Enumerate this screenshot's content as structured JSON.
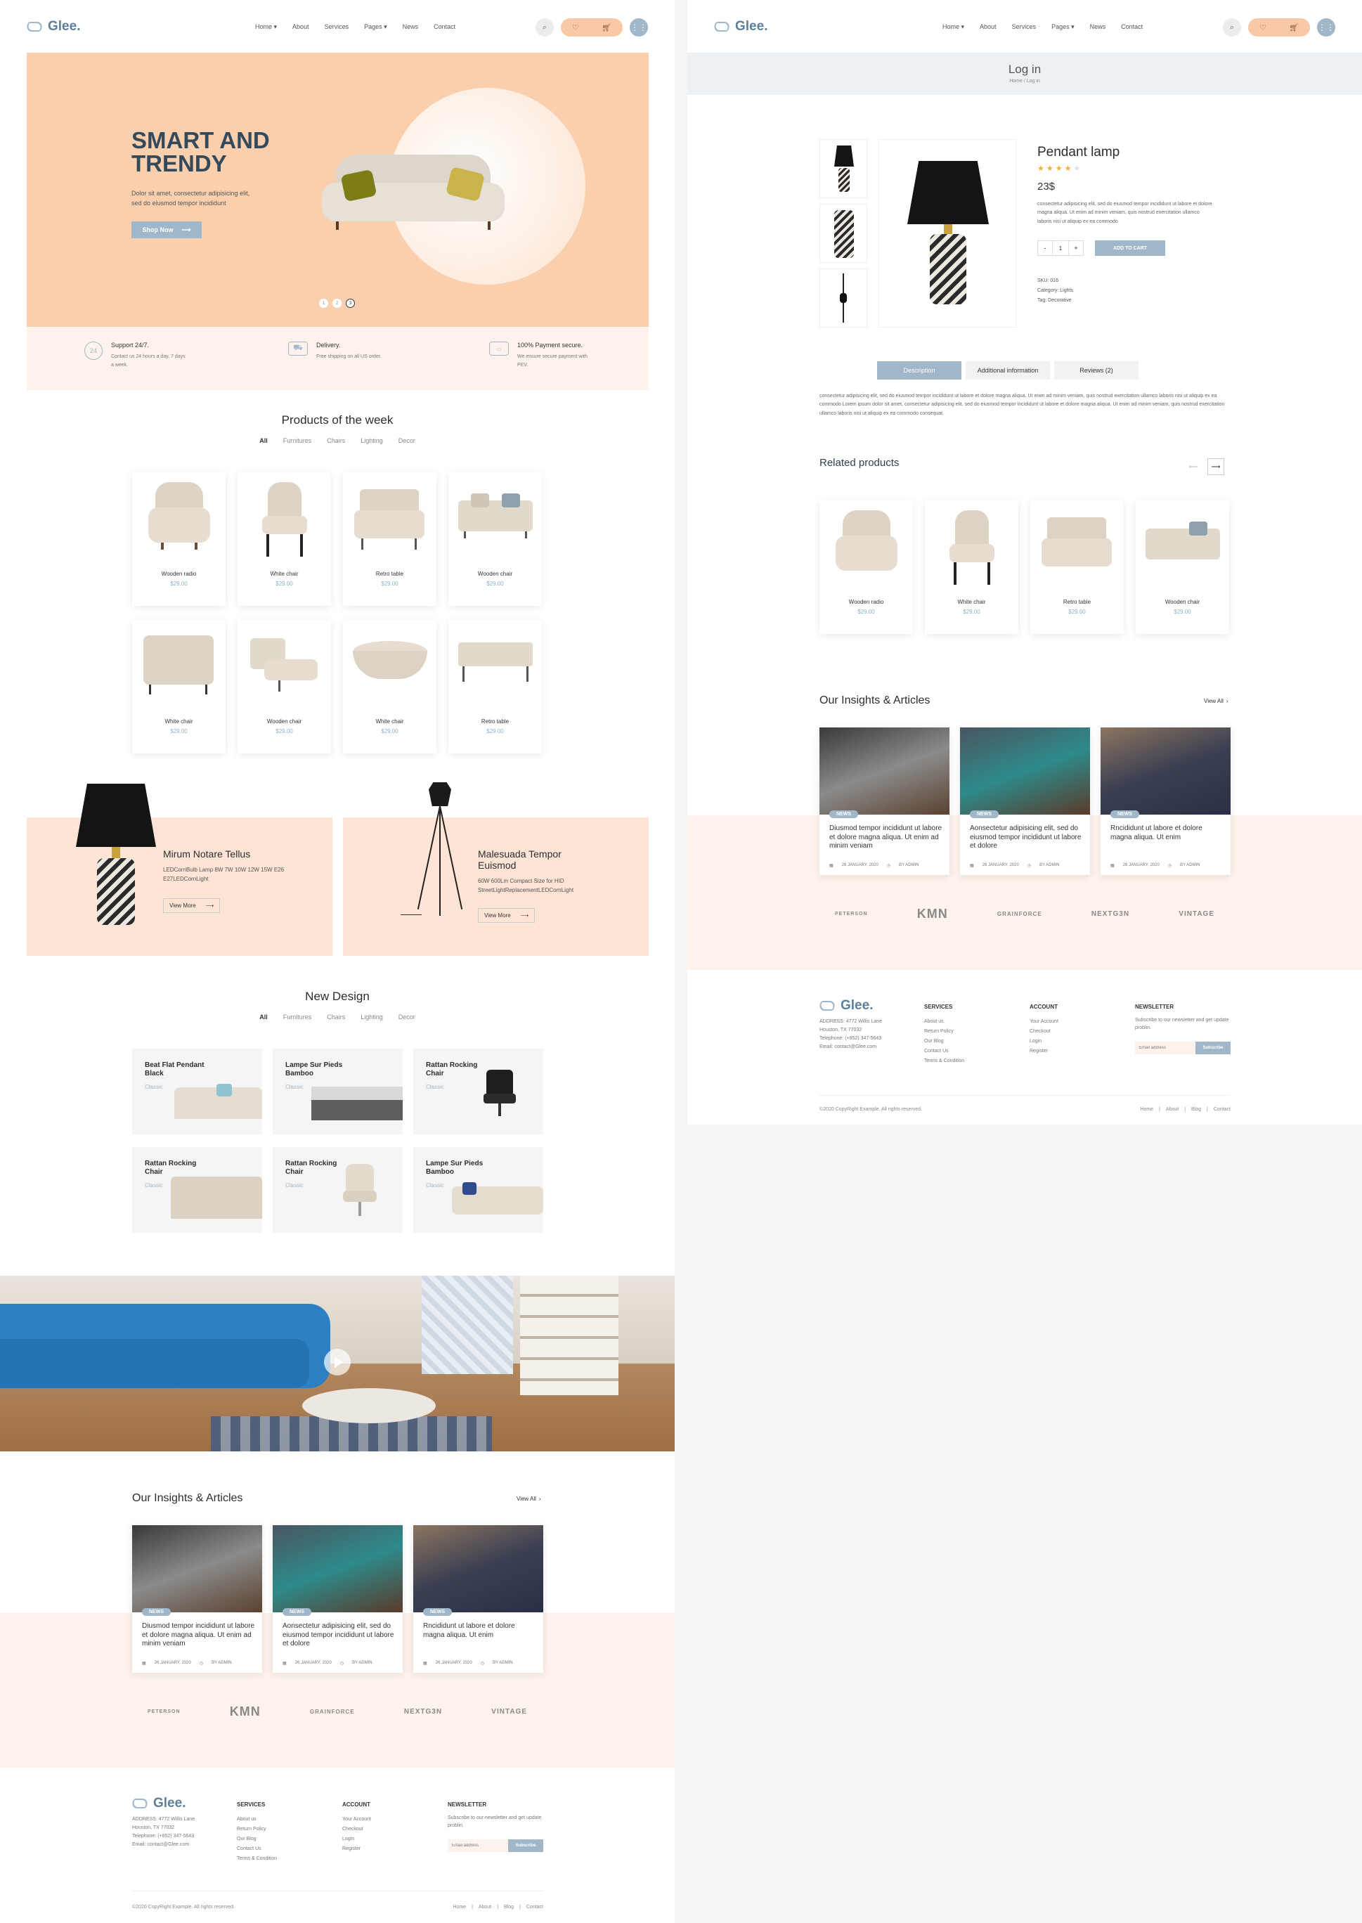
{
  "brand": {
    "name": "Glee."
  },
  "nav": [
    {
      "label": "Home ▾"
    },
    {
      "label": "About"
    },
    {
      "label": "Services"
    },
    {
      "label": "Pages ▾"
    },
    {
      "label": "News"
    },
    {
      "label": "Contact"
    }
  ],
  "hero": {
    "title_line1": "SMART AND",
    "title_line2": "TRENDY",
    "text": "Dolor sit amet, consectetur adipisicing elit, sed do eiusmod tempor incididunt",
    "button": "Shop Now",
    "dots": [
      "1",
      "2",
      "3"
    ]
  },
  "features": [
    {
      "title": "Support 24/7.",
      "text": "Contact us 24 hours a day, 7 days a week."
    },
    {
      "title": "Delivery.",
      "text": "Free shipping on all US order."
    },
    {
      "title": "100% Payment secure.",
      "text": "We ensure secure payment with PEV."
    }
  ],
  "products_week": {
    "title": "Products of the week",
    "filters": [
      "All",
      "Furnitures",
      "Chairs",
      "Lighting",
      "Decor"
    ],
    "items": [
      {
        "name": "Wooden radio",
        "price": "$29.00"
      },
      {
        "name": "White chair",
        "price": "$29.00"
      },
      {
        "name": "Retro table",
        "price": "$29.00"
      },
      {
        "name": "Wooden chair",
        "price": "$29.00"
      },
      {
        "name": "White chair",
        "price": "$29.00"
      },
      {
        "name": "Wooden chair",
        "price": "$29.00"
      },
      {
        "name": "White chair",
        "price": "$29.00"
      },
      {
        "name": "Retro table",
        "price": "$29.00"
      }
    ]
  },
  "promos": [
    {
      "title": "Mirum Notare Tellus",
      "text": "LEDCornBulb Lamp 8W 7W 10W 12W 15W E26 E27LEDCornLight",
      "button": "View More"
    },
    {
      "title": "Malesuada Tempor Euismod",
      "text": "60W 600Lm Compact Size for HID StreetLightReplacementLEDCornLight",
      "button": "View More"
    }
  ],
  "new_design": {
    "title": "New Design",
    "filters": [
      "All",
      "Furnitures",
      "Chairs",
      "Lighting",
      "Decor"
    ],
    "items": [
      {
        "name": "Beat Flat Pendant Black",
        "tag": "Classic"
      },
      {
        "name": "Lampe Sur Pieds Bamboo",
        "tag": "Classic"
      },
      {
        "name": "Rattan Rocking Chair",
        "tag": "Classic"
      },
      {
        "name": "Rattan Rocking Chair",
        "tag": "Classic"
      },
      {
        "name": "Rattan Rocking Chair",
        "tag": "Classic"
      },
      {
        "name": "Lampe Sur Pieds Bamboo",
        "tag": "Classic"
      }
    ]
  },
  "articles": {
    "title": "Our Insights & Articles",
    "view_all": "View All",
    "items": [
      {
        "badge": "NEWS",
        "title": "Diusmod tempor incididunt ut labore et dolore magna aliqua. Ut enim ad minim veniam",
        "date": "26 JANUARY, 2020",
        "author": "BY ADMIN"
      },
      {
        "badge": "NEWS",
        "title": "Aonsectetur adipisicing elit, sed do eiusmod tempor incididunt ut labore et dolore",
        "date": "26 JANUARY, 2020",
        "author": "BY ADMIN"
      },
      {
        "badge": "NEWS",
        "title": "Rncididunt ut labore et dolore magna aliqua. Ut enim",
        "date": "26 JANUARY, 2020",
        "author": "BY ADMIN"
      }
    ]
  },
  "brands": [
    "PETERSON",
    "KMN",
    "GRAINFORCE",
    "NEXTG3N",
    "VINTAGE"
  ],
  "footer": {
    "address": [
      "ADDRESS: 4772 Willis Lane",
      "Houston, TX 77032",
      "Telephone: (+852) 347-5643",
      "Email: contact@Glee.com"
    ],
    "services_title": "SERVICES",
    "services": [
      "About us",
      "Return Policy",
      "Our Blog",
      "Contact Us",
      "Terms & Condition"
    ],
    "account_title": "ACCOUNT",
    "account": [
      "Your Account",
      "Checkout",
      "Login",
      "Register"
    ],
    "newsletter_title": "NEWSLETTER",
    "newsletter_text": "Subscribe to our newsletter and get update problin.",
    "email_placeholder": "Email address",
    "subscribe": "Subscribe",
    "copyright": "©2020 CopyRight Example. All rights reserved.",
    "links": [
      "Home",
      "About",
      "Blog",
      "Contact"
    ]
  },
  "login": {
    "title": "Log in",
    "breadcrumb": "Home / Log in"
  },
  "product": {
    "name": "Pendant lamp",
    "rating": 4,
    "price": "23$",
    "desc": "consectetur adipisicing elit, sed do eiusmod tempor incididunt ut labore et dolore magna aliqua. Ut enim ad minim veniam, quis nostrud exercitation ullamco laboris nisi ut aliquip ex ea commodo",
    "qty_minus": "-",
    "qty": "1",
    "qty_plus": "+",
    "add_to_cart": "ADD TO CART",
    "sku": "SKU: 016",
    "category": "Category: Lights",
    "tag": "Tag: Decorative",
    "tabs": [
      "Description",
      "Additional information",
      "Reviews (2)"
    ],
    "tab_text": "consectetur adipisicing elit, sed do eiusmod tempor incididunt ut labore et dolore magna aliqua. Ut enim ad minim veniam, quis nostrud exercitation ullamco laboris nisi ut aliquip ex ea commodo Lorem ipsum dolor sit amet, consectetur adipisicing elit, sed do eiusmod tempor incididunt ut labore et dolore magna aliqua. Ut enim ad minim veniam, quis nostrud exercitation ullamco laboris nisi ut aliquip ex ea commodo consequat."
  },
  "related": {
    "title": "Related products",
    "prev": "⟵",
    "next": "⟶",
    "items": [
      {
        "name": "Wooden radio",
        "price": "$29.00"
      },
      {
        "name": "White chair",
        "price": "$29.00"
      },
      {
        "name": "Retro table",
        "price": "$29.00"
      },
      {
        "name": "Wooden chair",
        "price": "$29.00"
      }
    ]
  },
  "colors": {
    "peach": "#f7c9a6",
    "peach_light": "#fde4d4",
    "accent": "#9fb7c8",
    "brand_blue": "#5e7f97"
  }
}
